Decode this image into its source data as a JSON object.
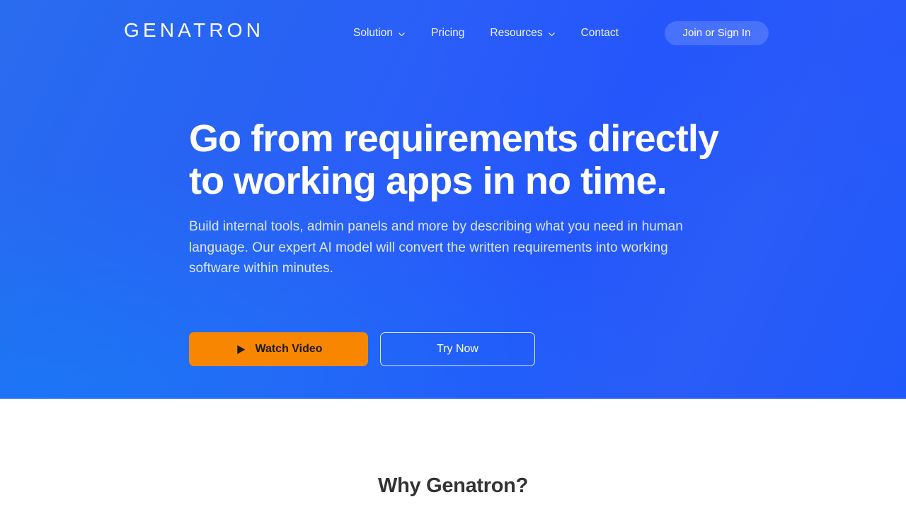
{
  "brand": {
    "logo_text": "GENATRON",
    "accent_blue": "#2a5ef8",
    "accent_orange": "#f98600",
    "hero_text_color": "#ffffff"
  },
  "nav": {
    "items": [
      {
        "label": "Solution",
        "has_dropdown": true,
        "icon": "chevron-down-icon"
      },
      {
        "label": "Pricing",
        "has_dropdown": false
      },
      {
        "label": "Resources",
        "has_dropdown": true,
        "icon": "chevron-down-icon"
      },
      {
        "label": "Contact",
        "has_dropdown": false
      }
    ],
    "signin_label": "Join or Sign In"
  },
  "hero": {
    "headline_line1": "Go from requirements directly",
    "headline_line2": "to working apps in no time.",
    "subhead": "Build internal tools, admin panels and more by describing what you need in human language. Our expert AI model will convert the written requirements into working software within minutes.",
    "cta_primary": "Watch Video",
    "cta_primary_icon": "play-icon",
    "cta_secondary": "Try Now"
  },
  "why_section": {
    "title": "Why Genatron?"
  }
}
